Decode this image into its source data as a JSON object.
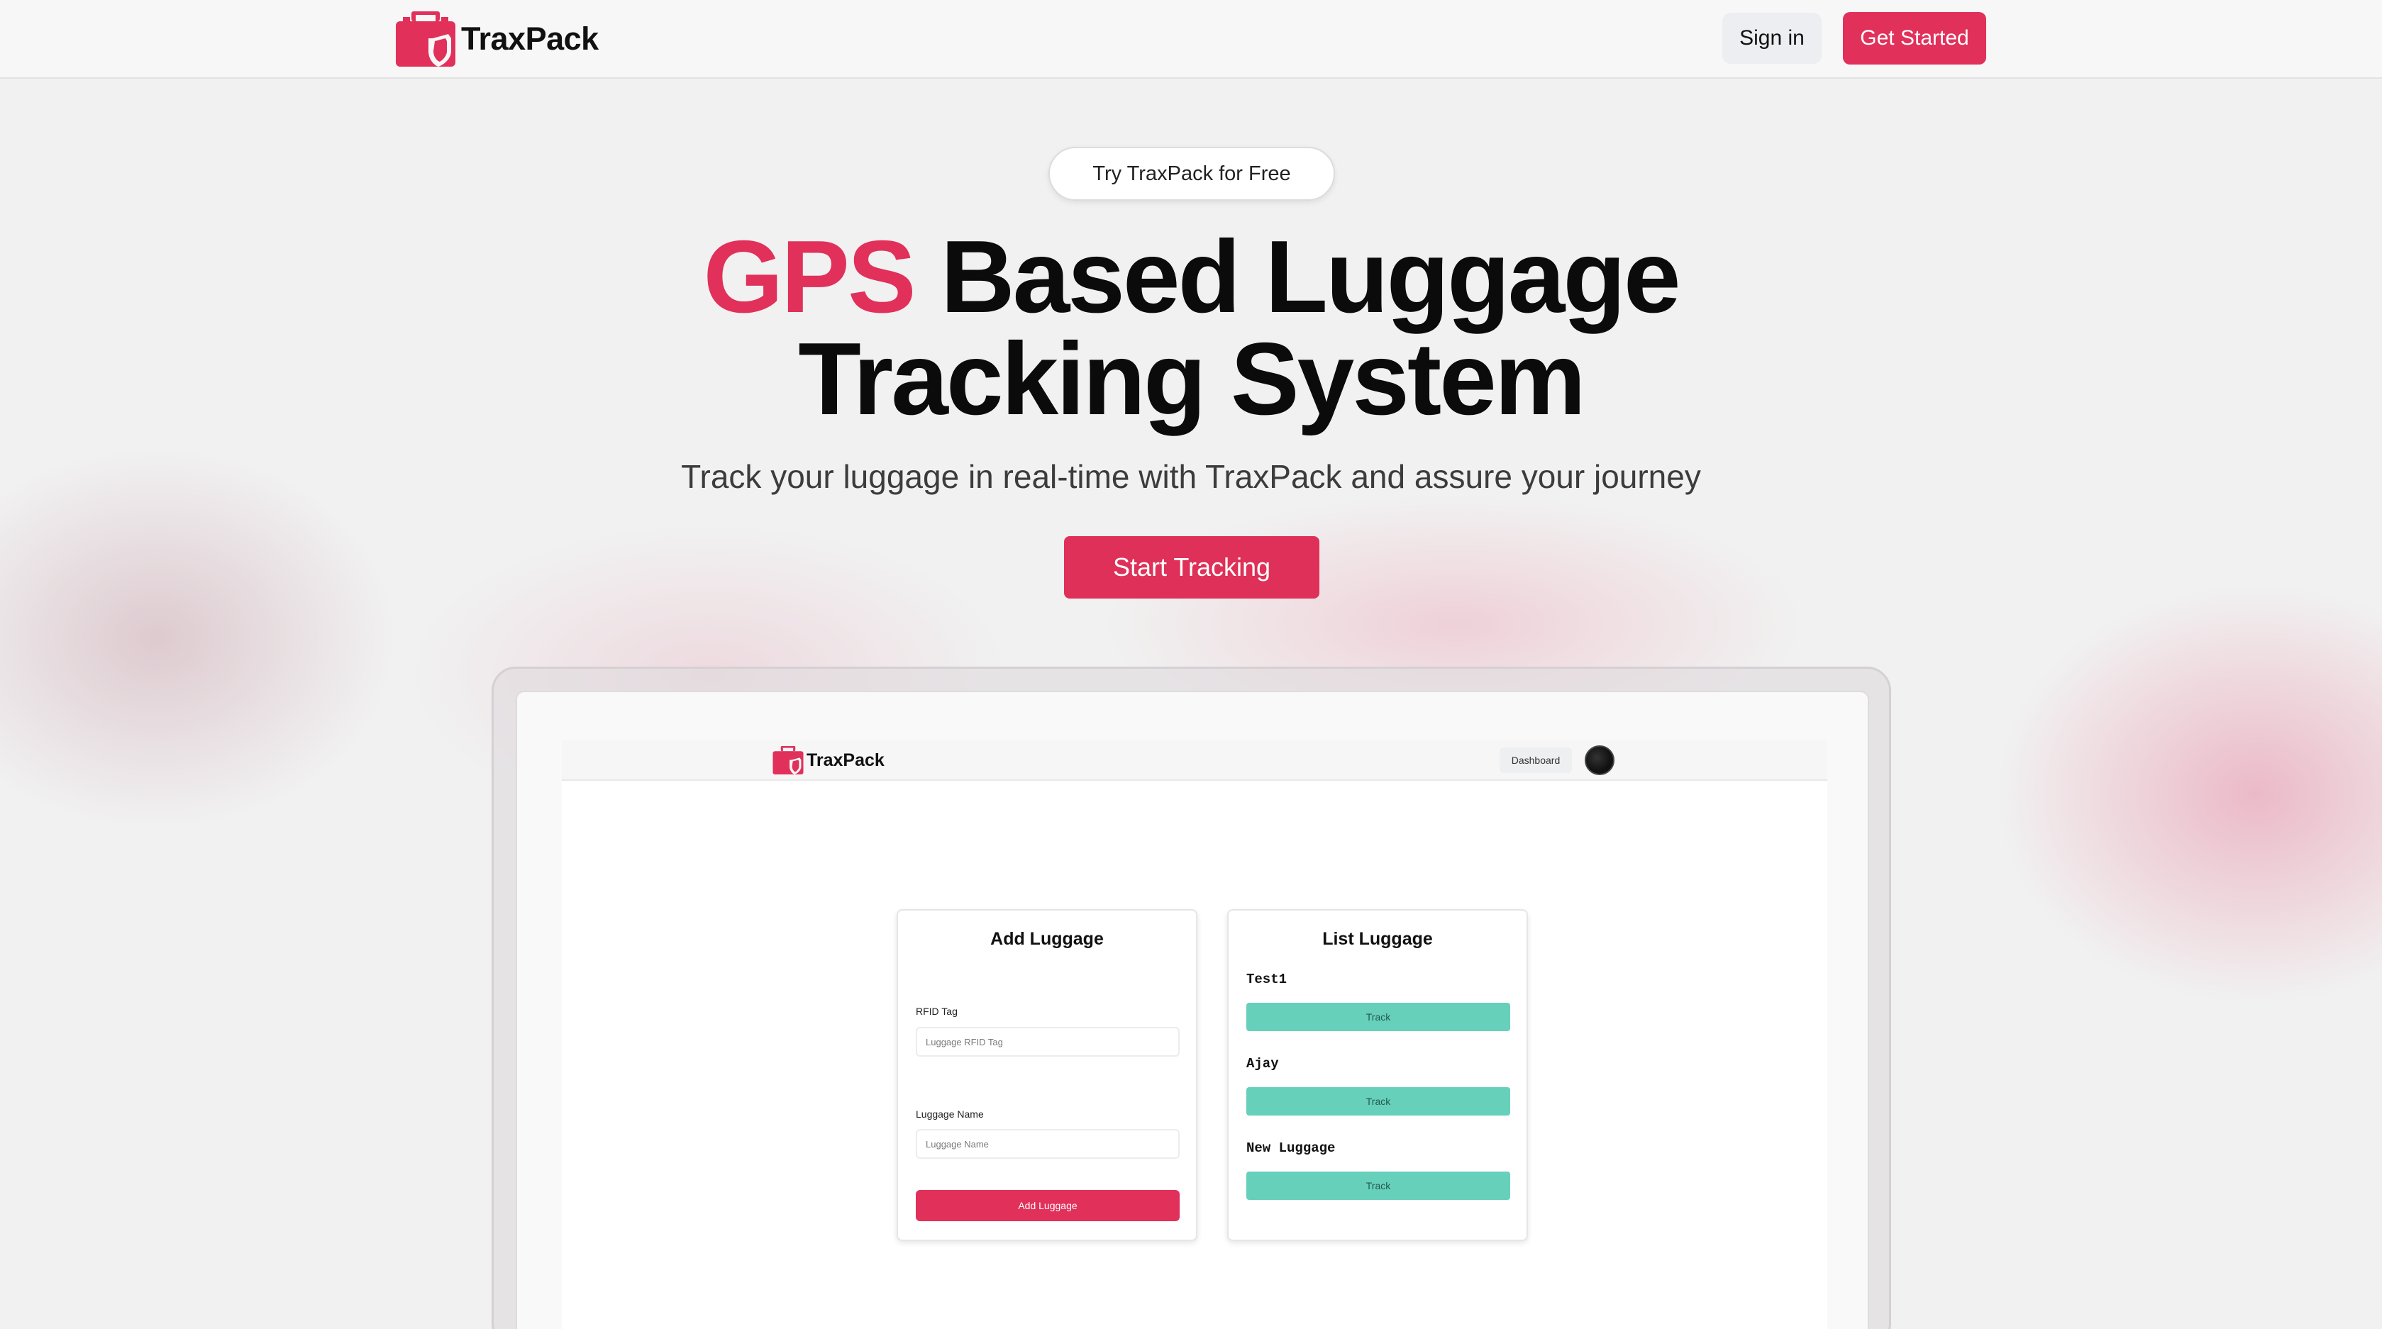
{
  "header": {
    "brand": "TraxPack",
    "logo_icon": "luggage-shield-icon",
    "signin_label": "Sign in",
    "get_started_label": "Get Started"
  },
  "hero": {
    "pill_label": "Try TraxPack for Free",
    "title_accent": "GPS",
    "title_line1_rest": " Based Luggage",
    "title_line2": "Tracking System",
    "subtitle": "Track your luggage in real-time with TraxPack and assure your journey",
    "cta_label": "Start Tracking"
  },
  "preview": {
    "app_brand": "TraxPack",
    "dashboard_label": "Dashboard",
    "add_card": {
      "title": "Add Luggage",
      "rfid_label": "RFID Tag",
      "rfid_placeholder": "Luggage RFID Tag",
      "name_label": "Luggage Name",
      "name_placeholder": "Luggage Name",
      "button_label": "Add Luggage"
    },
    "list_card": {
      "title": "List Luggage",
      "items": [
        {
          "name": "Test1",
          "action": "Track"
        },
        {
          "name": "Ajay",
          "action": "Track"
        },
        {
          "name": "New Luggage",
          "action": "Track"
        }
      ]
    }
  },
  "colors": {
    "accent": "#e1305a",
    "track_button": "#66d0bb"
  }
}
